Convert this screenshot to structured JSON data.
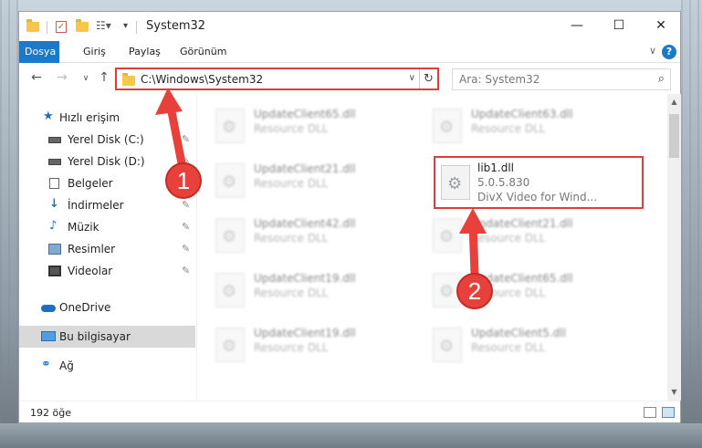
{
  "window": {
    "title": "System32",
    "controls": {
      "minimize": "—",
      "maximize": "☐",
      "close": "✕"
    }
  },
  "ribbon": {
    "tabs": [
      "Dosya",
      "Giriş",
      "Paylaş",
      "Görünüm"
    ],
    "active_tab": "Dosya",
    "help": "?",
    "collapse": "∨"
  },
  "nav": {
    "back": "←",
    "forward": "→",
    "recent": "∨",
    "up": "↑",
    "address": "C:\\Windows\\System32",
    "address_dropdown": "∨",
    "refresh": "↻",
    "search_placeholder": "Ara: System32",
    "search_icon": "⌕"
  },
  "sidebar": {
    "items": [
      {
        "label": "Hızlı erişim",
        "icon": "star-icon",
        "glyph": "★"
      },
      {
        "label": "Yerel Disk (C:)",
        "icon": "drive-icon",
        "glyph": ""
      },
      {
        "label": "Yerel Disk (D:)",
        "icon": "drive-icon",
        "glyph": ""
      },
      {
        "label": "Belgeler",
        "icon": "document-icon",
        "glyph": ""
      },
      {
        "label": "İndirmeler",
        "icon": "download-icon",
        "glyph": "↓"
      },
      {
        "label": "Müzik",
        "icon": "music-icon",
        "glyph": "♪"
      },
      {
        "label": "Resimler",
        "icon": "pictures-icon",
        "glyph": ""
      },
      {
        "label": "Videolar",
        "icon": "video-icon",
        "glyph": ""
      },
      {
        "label": "OneDrive",
        "icon": "cloud-icon",
        "glyph": ""
      },
      {
        "label": "Bu bilgisayar",
        "icon": "computer-icon",
        "glyph": ""
      },
      {
        "label": "Ağ",
        "icon": "network-icon",
        "glyph": "⚭"
      }
    ],
    "pin_glyph": "📌",
    "selected": "Bu bilgisayar"
  },
  "files": {
    "left": [
      {
        "name": "UpdateClient65.dll",
        "desc": "Resource DLL"
      },
      {
        "name": "UpdateClient21.dll",
        "desc": "Resource DLL"
      },
      {
        "name": "UpdateClient42.dll",
        "desc": "Resource DLL"
      },
      {
        "name": "UpdateClient19.dll",
        "desc": "Resource DLL"
      },
      {
        "name": "UpdateClient19.dll",
        "desc": "Resource DLL"
      }
    ],
    "right": [
      {
        "name": "UpdateClient63.dll",
        "desc": "Resource DLL"
      },
      {
        "name": "UpdateClient21.dll",
        "desc": "Resource DLL"
      },
      {
        "name": "UpdateClient65.dll",
        "desc": "Resource DLL"
      },
      {
        "name": "UpdateClient5.dll",
        "desc": "Resource DLL"
      }
    ],
    "highlighted": {
      "name": "lib1.dll",
      "version": "5.0.5.830",
      "desc": "DivX Video for Wind..."
    }
  },
  "status": {
    "count": "192 öğe"
  },
  "callouts": {
    "one": "1",
    "two": "2"
  },
  "colors": {
    "accent": "#1979ca",
    "highlight": "#e03c3c",
    "callout": "#e8413c"
  }
}
